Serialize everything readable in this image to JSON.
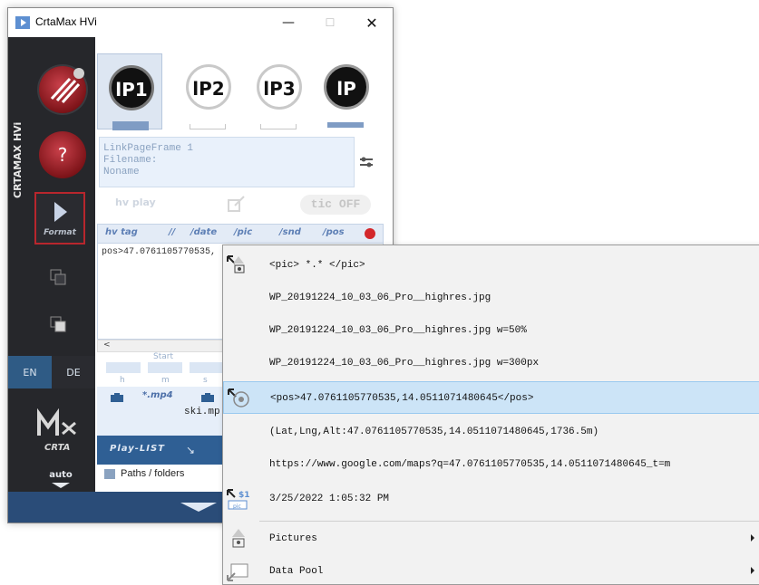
{
  "window": {
    "title": "CrtaMax HVi",
    "controls": {
      "minimize": "—",
      "maximize": "☐",
      "close": "✕"
    }
  },
  "sidebar": {
    "brand_vertical": "CRTAMAX HVi",
    "help_label": "?",
    "format_label": "Format",
    "lang_en": "EN",
    "lang_de": "DE",
    "logo_text": "CRTA",
    "auto_label": "auto"
  },
  "lp_tabs": [
    {
      "label": "lP1",
      "active": true
    },
    {
      "label": "lP2",
      "active": false
    },
    {
      "label": "lP3",
      "active": false
    },
    {
      "label": "lP",
      "active": false
    }
  ],
  "info": {
    "line1": "LinkPageFrame 1",
    "line2": "Filename:",
    "line3": "Noname"
  },
  "faded_toolbar": {
    "hv_play": "hv play",
    "tic_off": "tic OFF"
  },
  "tag_toolbar": {
    "hvtag": "hv tag",
    "slashes": "//",
    "date": "/date",
    "pic": "/pic",
    "snd": "/snd",
    "pos": "/pos"
  },
  "editor": {
    "text": "pos>47.0761105770535,"
  },
  "scroll": {
    "left_arrow": "<"
  },
  "times": {
    "start_label": "Start",
    "h": "h",
    "m": "m",
    "s": "s"
  },
  "media": {
    "mp4_label": "*.mp4",
    "file": "ski.mp"
  },
  "playlist": {
    "label": "Play-LIST",
    "arrow": "↘"
  },
  "paths": {
    "label": "Paths / folders"
  },
  "context_menu": {
    "items": [
      {
        "text": "<pic> *.* </pic>",
        "icon": "photo-pick-icon"
      },
      {
        "text": "WP_20191224_10_03_06_Pro__highres.jpg"
      },
      {
        "text": "WP_20191224_10_03_06_Pro__highres.jpg w=50%"
      },
      {
        "text": "WP_20191224_10_03_06_Pro__highres.jpg w=300px"
      },
      {
        "text": "<pos>47.0761105770535,14.0511071480645</pos>",
        "icon": "position-target-icon",
        "highlighted": true
      },
      {
        "text": "(Lat,Lng,Alt:47.0761105770535,14.0511071480645,1736.5m)"
      },
      {
        "text": "https://www.google.com/maps?q=47.0761105770535,14.0511071480645_t=m"
      },
      {
        "text": "3/25/2022 1:05:32 PM",
        "icon": "pic-info-icon"
      },
      {
        "text": "Pictures",
        "icon": "pictures-icon",
        "submenu": true
      },
      {
        "text": "Data Pool",
        "icon": "data-pool-icon",
        "submenu": true
      }
    ]
  },
  "colors": {
    "sidebar_bg": "#26272b",
    "accent_blue": "#2f5f94",
    "highlight": "#cce4f7",
    "brand_red": "#b8262d"
  }
}
